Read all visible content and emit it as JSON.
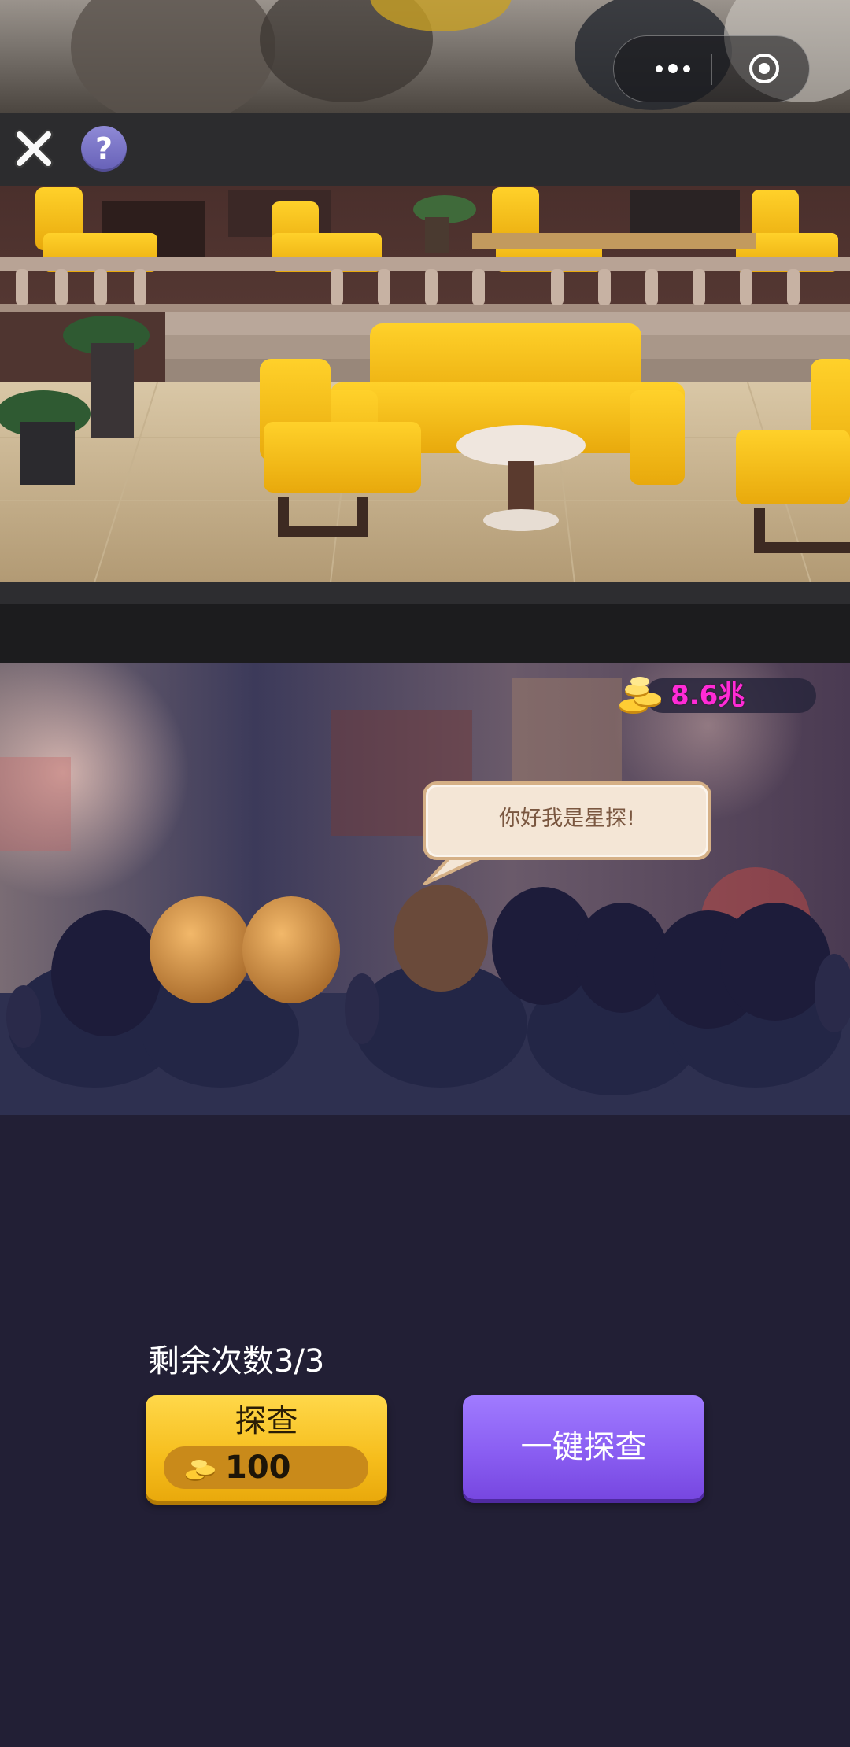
{
  "menu_capsule": {
    "more_icon": "more-dots-icon",
    "close_icon": "target-circle-icon"
  },
  "toolbar": {
    "close_icon": "close-x-icon",
    "help_label": "?"
  },
  "scene": {
    "name": "hotel-lounge",
    "accent": "#f2b81a"
  },
  "currency": {
    "icon": "gold-coins-icon",
    "value": "8.6兆",
    "color": "#ff2bd6"
  },
  "dialog": {
    "text": "你好我是星探!"
  },
  "controls": {
    "remaining": "剩余次数3/3",
    "investigate_label": "探查",
    "cost_icon": "gold-coins-icon",
    "cost_value": "100",
    "one_click_label": "一键探查"
  },
  "colors": {
    "background": "#221f35",
    "yellow_button": "#f6bd1c",
    "purple_button": "#8a5ef2"
  }
}
